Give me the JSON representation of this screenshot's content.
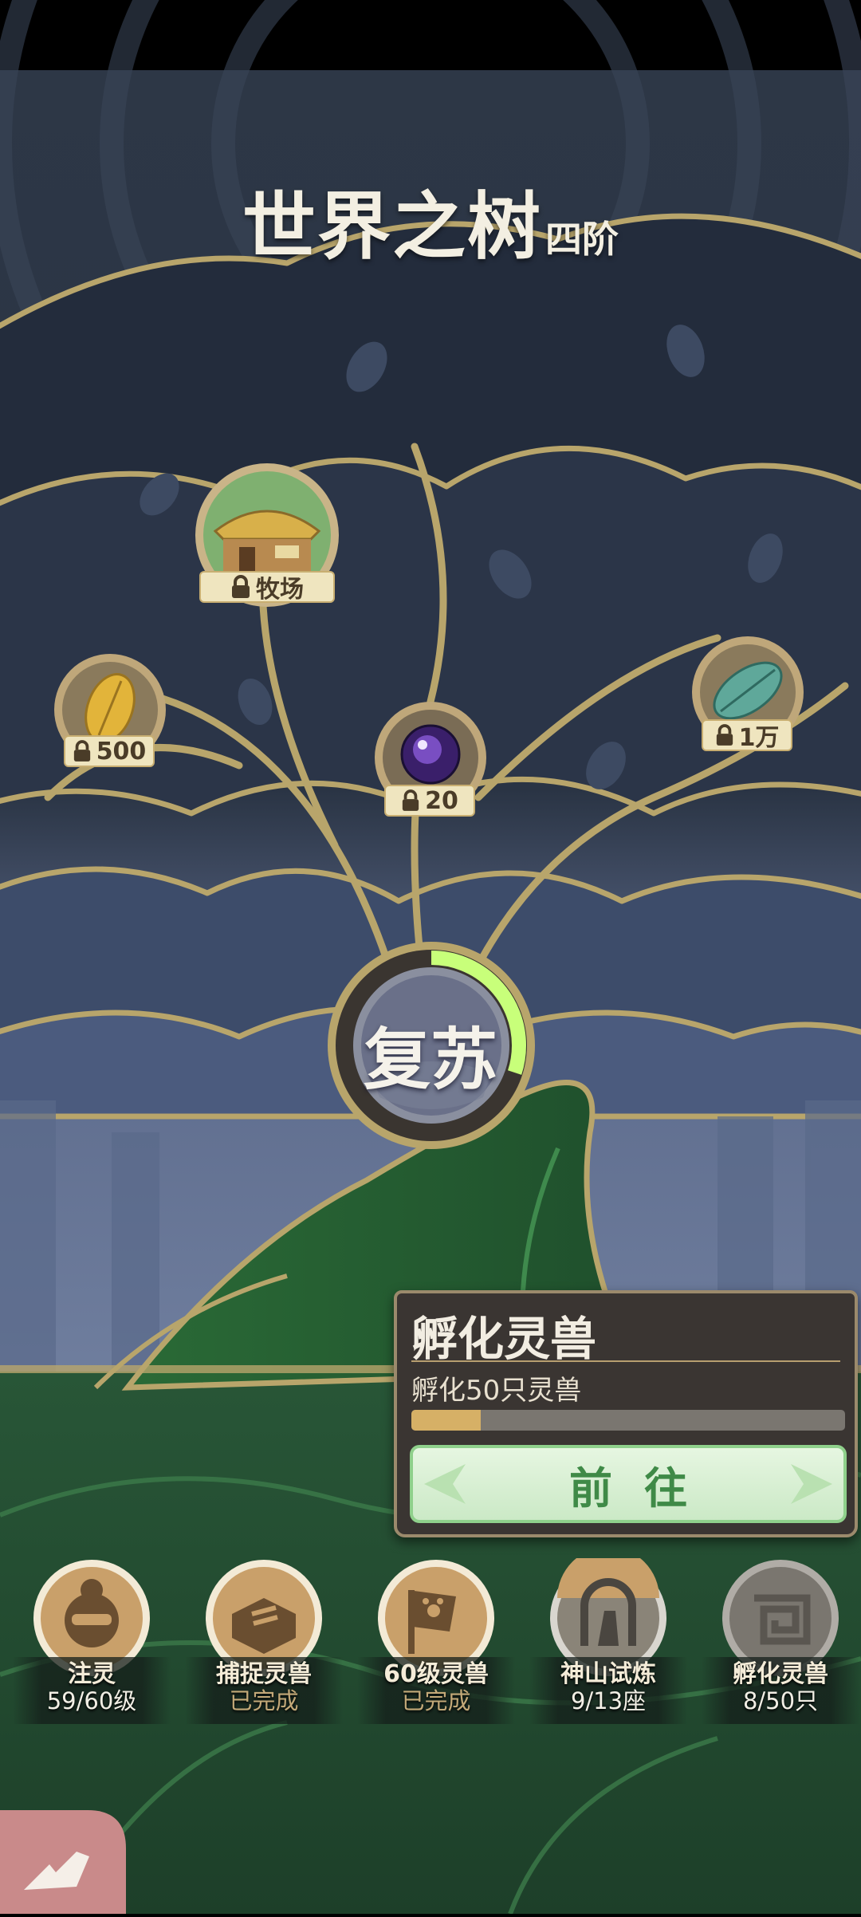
{
  "title": {
    "main": "世界之树",
    "sub": "四阶"
  },
  "tree_nodes": [
    {
      "id": "pasture",
      "lock_label": "牧场",
      "icon": "pasture-farm-icon"
    },
    {
      "id": "gold-leaf",
      "lock_label": "500",
      "icon": "gold-leaf-icon"
    },
    {
      "id": "purple-orb",
      "lock_label": "20",
      "icon": "purple-orb-icon"
    },
    {
      "id": "jade-leaf",
      "lock_label": "1万",
      "icon": "jade-leaf-icon"
    }
  ],
  "revive": {
    "label": "复苏",
    "progress": 0.3
  },
  "quest": {
    "title": "孵化灵兽",
    "description": "孵化50只灵兽",
    "progress": 0.16,
    "button_label": "前往"
  },
  "tasks": [
    {
      "name": "注灵",
      "status": "59/60级",
      "icon": "mask-face-icon",
      "completed": false
    },
    {
      "name": "捕捉灵兽",
      "status": "已完成",
      "icon": "box-trap-icon",
      "completed": true
    },
    {
      "name": "60级灵兽",
      "status": "已完成",
      "icon": "paw-flag-icon",
      "completed": true
    },
    {
      "name": "神山试炼",
      "status": "9/13座",
      "icon": "mountain-shield-icon",
      "completed": false
    },
    {
      "name": "孵化灵兽",
      "status": "8/50只",
      "icon": "spiral-rune-icon",
      "completed": false
    }
  ],
  "colors": {
    "sky_dark": "#1f2836",
    "branch_gold": "#b8a56b",
    "leaf_blue": "#3a4a62",
    "trunk_green": "#2f6a3a",
    "progress_green": "#c8ff7a",
    "accent_gold": "#d6b066"
  }
}
